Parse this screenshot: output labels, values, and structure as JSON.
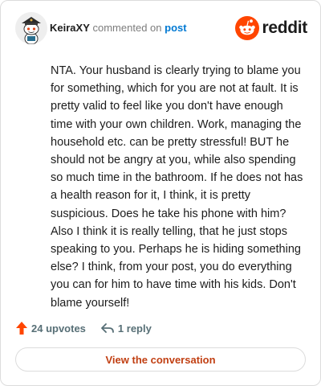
{
  "header": {
    "username": "KeiraXY",
    "action_text": "commented on",
    "post_link": "post",
    "brand_name": "reddit",
    "avatar_icon": "snoo-avatar-icon",
    "brand_icon": "reddit-logo-icon"
  },
  "comment": {
    "text": "NTA. Your husband is clearly trying to blame you for something, which for you are not at fault. It is pretty valid to feel like you don't have enough time with your own children. Work, managing the household etc. can be pretty stressful! BUT he should not be angry at you, while also spending so much time in the bathroom. If he does not has a health reason for it, I think, it is pretty suspicious. Does he take his phone with him? Also I think it is really telling, that he just stops speaking to you. Perhaps he is hiding something else? I think, from your post, you do everything you can for him to have time with his kids. Don't blame yourself!"
  },
  "actions": {
    "upvotes": "24 upvotes",
    "replies": "1 reply",
    "upvote_icon": "upvote-arrow-icon",
    "reply_icon": "reply-arrow-icon"
  },
  "cta": {
    "label": "View the conversation"
  },
  "colors": {
    "brand_orange": "#ff4500",
    "link_blue": "#0079d3",
    "cta_text": "#c13f12",
    "muted_text": "#576f76"
  }
}
